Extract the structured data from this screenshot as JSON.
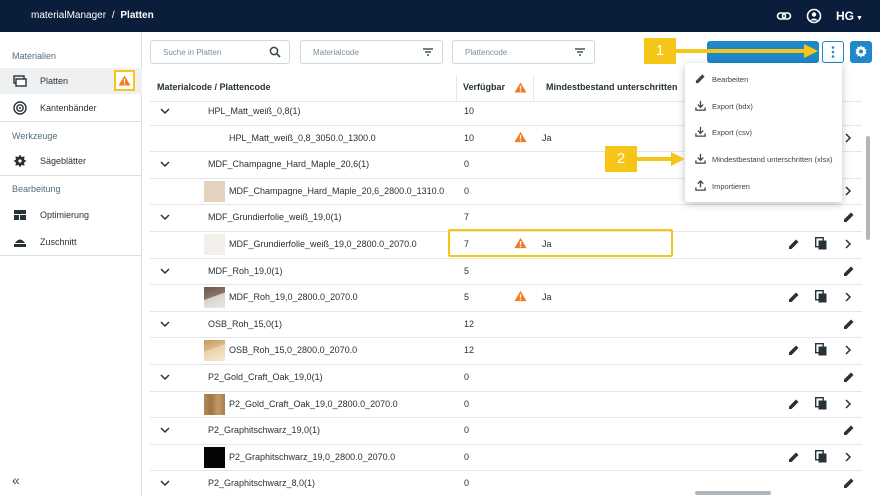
{
  "app": {
    "name": "materialManager",
    "separator": "/",
    "page": "Platten",
    "logo": "HG"
  },
  "icons": {
    "link": "link-icon",
    "user": "user-icon",
    "search": "search-icon",
    "filter": "filter-icon",
    "more": "more-vert-icon",
    "settings": "gear-icon"
  },
  "colors": {
    "navy": "#0a1e3c",
    "accent": "#1e88c8",
    "warning": "#f07b22",
    "highlight": "#f5c518"
  },
  "sidebar": {
    "sections": [
      {
        "title": "Materialien",
        "items": [
          {
            "label": "Platten",
            "icon": "board-icon",
            "active": true
          },
          {
            "label": "Kantenbänder",
            "icon": "edge-roll-icon"
          }
        ]
      },
      {
        "title": "Werkzeuge",
        "items": [
          {
            "label": "Sägeblätter",
            "icon": "saw-blade-icon"
          }
        ]
      },
      {
        "title": "Bearbeitung",
        "items": [
          {
            "label": "Optimierung",
            "icon": "optimization-icon"
          },
          {
            "label": "Zuschnitt",
            "icon": "cutting-icon"
          }
        ]
      }
    ],
    "collapse_label": "«"
  },
  "filters": {
    "search_placeholder": "Suche in Platten",
    "materialcode_placeholder": "Materialcode",
    "plattencode_placeholder": "Plattencode"
  },
  "table": {
    "headers": {
      "code": "Materialcode / Plattencode",
      "available": "Verfügbar",
      "below_min": "Mindestbestand unterschritten"
    },
    "rows": [
      {
        "type": "group",
        "code": "HPL_Matt_weiß_0,8(1)",
        "qty": "10"
      },
      {
        "type": "item",
        "code": "HPL_Matt_weiß_0,8_3050.0_1300.0",
        "qty": "10",
        "warn": true,
        "below": "Ja",
        "thumb": "none"
      },
      {
        "type": "group",
        "code": "MDF_Champagne_Hard_Maple_20,6(1)",
        "qty": "0"
      },
      {
        "type": "item",
        "code": "MDF_Champagne_Hard_Maple_20,6_2800.0_1310.0",
        "qty": "0",
        "warn": false,
        "below": "",
        "thumb": "maple"
      },
      {
        "type": "group",
        "code": "MDF_Grundierfolie_weiß_19,0(1)",
        "qty": "7"
      },
      {
        "type": "item",
        "code": "MDF_Grundierfolie_weiß_19,0_2800.0_2070.0",
        "qty": "7",
        "warn": true,
        "below": "Ja",
        "thumb": "white"
      },
      {
        "type": "group",
        "code": "MDF_Roh_19,0(1)",
        "qty": "5"
      },
      {
        "type": "item",
        "code": "MDF_Roh_19,0_2800.0_2070.0",
        "qty": "5",
        "warn": true,
        "below": "Ja",
        "thumb": "mdf"
      },
      {
        "type": "group",
        "code": "OSB_Roh_15,0(1)",
        "qty": "12"
      },
      {
        "type": "item",
        "code": "OSB_Roh_15,0_2800.0_2070.0",
        "qty": "12",
        "warn": false,
        "below": "",
        "thumb": "osb"
      },
      {
        "type": "group",
        "code": "P2_Gold_Craft_Oak_19,0(1)",
        "qty": "0"
      },
      {
        "type": "item",
        "code": "P2_Gold_Craft_Oak_19,0_2800.0_2070.0",
        "qty": "0",
        "warn": false,
        "below": "",
        "thumb": "oak"
      },
      {
        "type": "group",
        "code": "P2_Graphitschwarz_19,0(1)",
        "qty": "0"
      },
      {
        "type": "item",
        "code": "P2_Graphitschwarz_19,0_2800.0_2070.0",
        "qty": "0",
        "warn": false,
        "below": "",
        "thumb": "black"
      },
      {
        "type": "group",
        "code": "P2_Graphitschwarz_8,0(1)",
        "qty": "0"
      }
    ]
  },
  "menu": {
    "items": [
      {
        "label": "Bearbeiten",
        "icon": "pencil-icon"
      },
      {
        "label": "Export (bdx)",
        "icon": "download-icon"
      },
      {
        "label": "Export (csv)",
        "icon": "download-icon"
      },
      {
        "label": "Mindestbestand unterschritten (xlsx)",
        "icon": "download-icon"
      },
      {
        "label": "Importieren",
        "icon": "upload-icon"
      }
    ]
  },
  "callouts": {
    "one": "1",
    "two": "2"
  }
}
